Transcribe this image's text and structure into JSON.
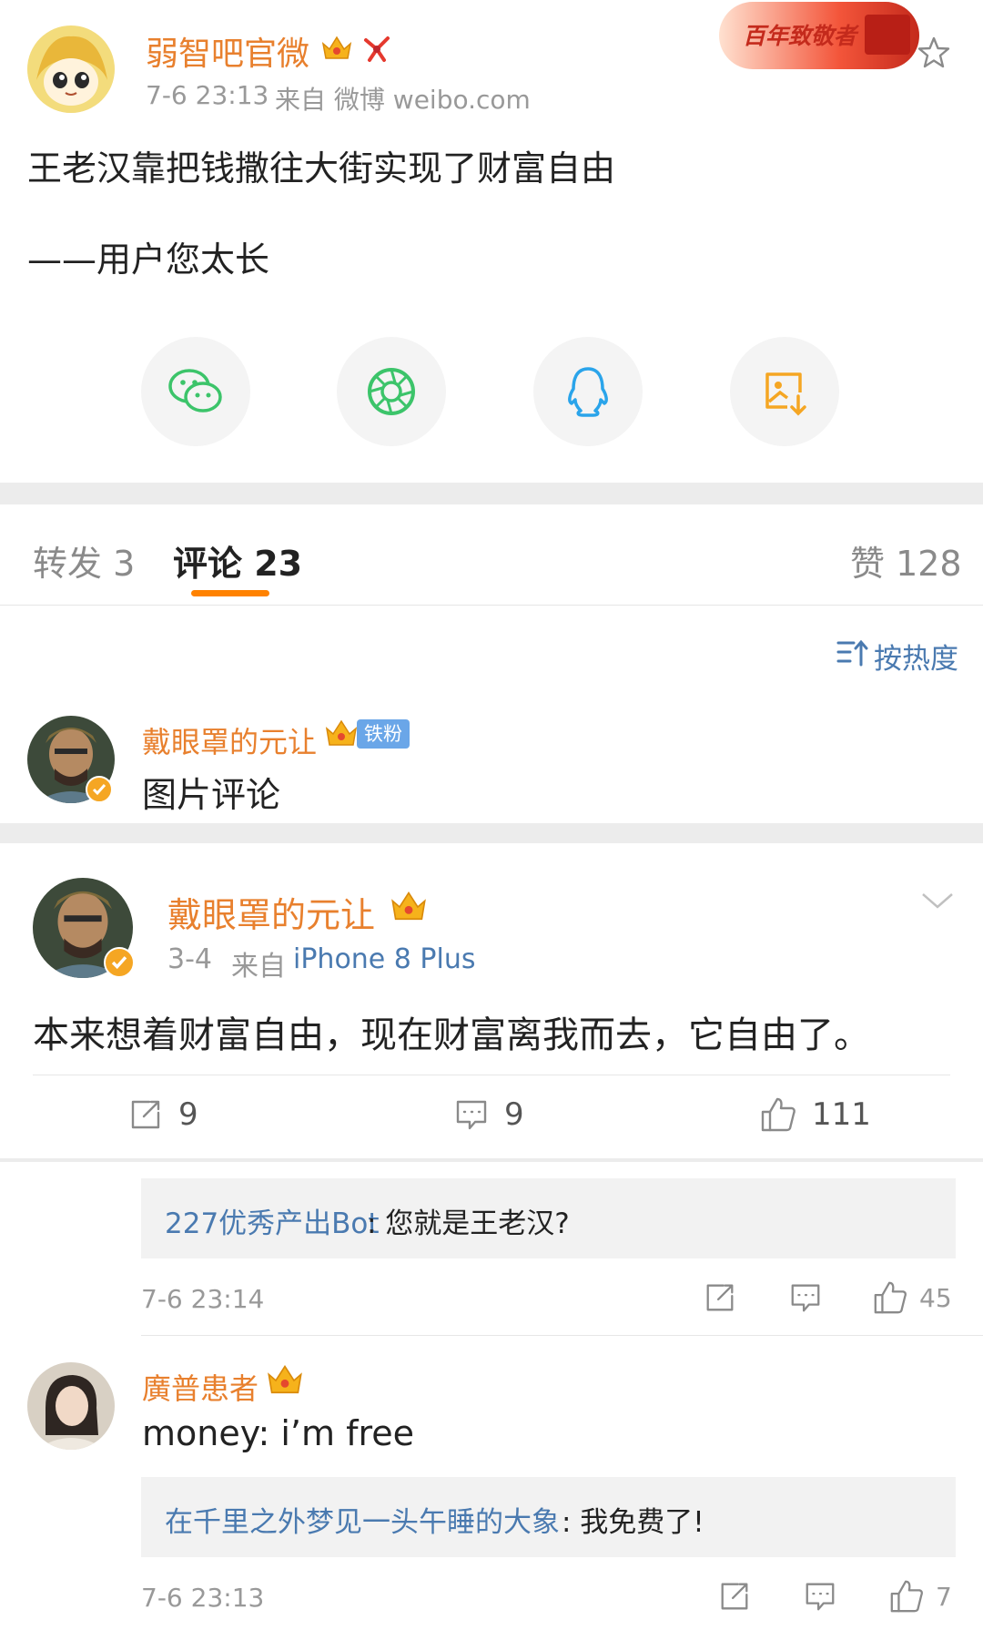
{
  "post": {
    "author": "弱智吧官微",
    "meta_time": "7-6 23:13",
    "meta_from": "来自 微博 weibo.com",
    "text_line1": "王老汉靠把钱撒往大街实现了财富自由",
    "text_line2": "——用户您太长",
    "banner_text": "百年致敬者",
    "share_icons": [
      "wechat-icon",
      "moments-icon",
      "qq-icon",
      "save-image-icon"
    ]
  },
  "tabs": {
    "repost": "转发 3",
    "comment": "评论 23",
    "like": "赞 128",
    "sort": "按热度"
  },
  "preview_comment": {
    "name": "戴眼罩的元让",
    "badge": "铁粉",
    "text": "图片评论"
  },
  "main_comment": {
    "name": "戴眼罩的元让",
    "time": "3-4",
    "from_prefix": "来自",
    "from_device": "iPhone 8 Plus",
    "text": "本来想着财富自由，现在财富离我而去，它自由了。",
    "repost_count": "9",
    "comment_count": "9",
    "like_count": "111"
  },
  "reply1": {
    "author": "227优秀产出Bot",
    "text": ": 您就是王老汉?",
    "time": "7-6 23:14",
    "like_count": "45"
  },
  "comment2": {
    "name": "廣普患者",
    "text": "money: i’m free",
    "reply_author": "在千里之外梦见一头午睡的大象",
    "reply_text": ": 我免费了!",
    "time": "7-6 23:13",
    "like_count": "7"
  },
  "colors": {
    "accent_orange": "#e8802e",
    "link_blue": "#4a7ab0",
    "tab_underline": "#ff8200"
  }
}
